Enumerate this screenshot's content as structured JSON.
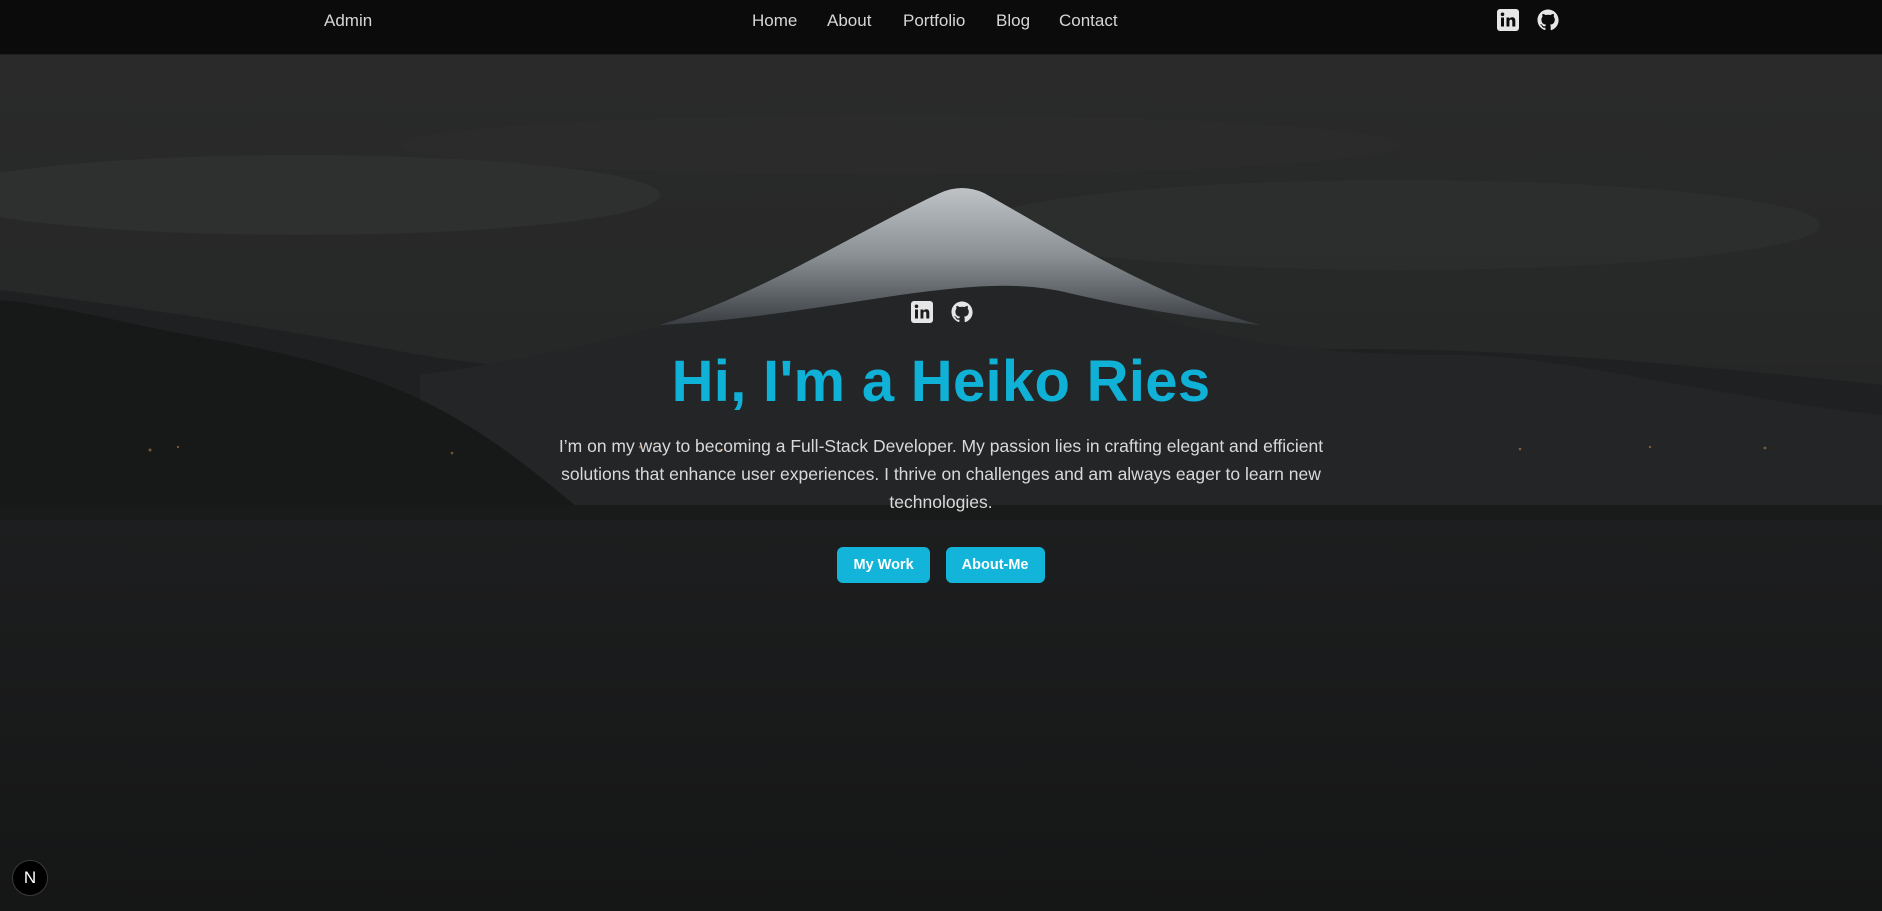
{
  "nav": {
    "admin_label": "Admin",
    "links": [
      "Home",
      "About",
      "Portfolio",
      "Blog",
      "Contact"
    ],
    "social": [
      "linkedin-icon",
      "github-icon"
    ]
  },
  "hero": {
    "social": [
      "linkedin-icon",
      "github-icon"
    ],
    "title": "Hi, I'm a Heiko Ries",
    "description": "I’m on my way to becoming a Full-Stack Developer. My passion lies in crafting elegant and efficient solutions that enhance user experiences. I thrive on challenges and am always eager to learn new technologies.",
    "buttons": {
      "primary": "My Work",
      "secondary": "About-Me"
    }
  },
  "dev_badge": {
    "label": "N"
  },
  "colors": {
    "accent": "#12b5d9",
    "title": "#0fb2d6",
    "nav_bg": "#0b0b0b",
    "text": "#d9d9d9"
  }
}
